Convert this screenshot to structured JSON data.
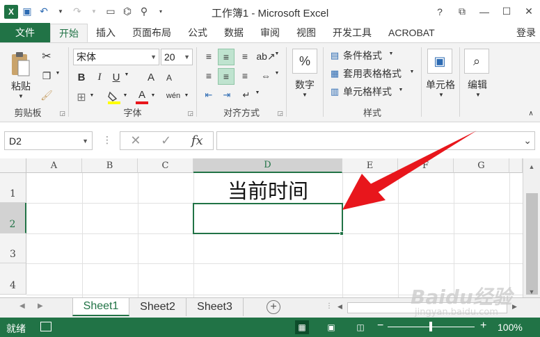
{
  "title_bar": {
    "title": "工作簿1 - Microsoft Excel",
    "logo": "X",
    "qat_icons": [
      "save-icon",
      "undo-icon",
      "redo-icon",
      "form-icon",
      "tree-icon",
      "pin-icon",
      "customize-icon"
    ],
    "window_buttons": [
      "?",
      "⧉",
      "—",
      "☐",
      "✕"
    ]
  },
  "tabs": {
    "file": "文件",
    "items": [
      "开始",
      "插入",
      "页面布局",
      "公式",
      "数据",
      "审阅",
      "视图",
      "开发工具",
      "ACROBAT"
    ],
    "active": "开始",
    "login": "登录"
  },
  "ribbon": {
    "clipboard": {
      "paste": "粘贴",
      "label": "剪贴板"
    },
    "font": {
      "name": "宋体",
      "size": "20",
      "bold": "B",
      "italic": "I",
      "underline": "U",
      "grow": "A",
      "shrink": "A",
      "font_color_glyph": "A",
      "wen": "wén",
      "label": "字体"
    },
    "alignment": {
      "label": "对齐方式"
    },
    "number": {
      "glyph": "%",
      "label_btn": "数字"
    },
    "styles": {
      "conditional": "条件格式",
      "table": "套用表格格式",
      "cell": "单元格样式",
      "label": "样式"
    },
    "cells": {
      "label_btn": "单元格"
    },
    "editing": {
      "label_btn": "编辑"
    }
  },
  "formula_bar": {
    "name_box": "D2",
    "cancel": "✕",
    "enter": "✓",
    "fx": "fx",
    "value": ""
  },
  "grid": {
    "columns": [
      "A",
      "B",
      "C",
      "D",
      "E",
      "F",
      "G"
    ],
    "selected_column": "D",
    "rows": [
      "1",
      "2",
      "3",
      "4"
    ],
    "selected_row": "2",
    "cells": {
      "D1": "当前时间"
    }
  },
  "sheets": {
    "tabs": [
      "Sheet1",
      "Sheet2",
      "Sheet3"
    ],
    "active": "Sheet1",
    "add": "+"
  },
  "status_bar": {
    "status": "就绪",
    "zoom": "100%",
    "zoom_minus": "−",
    "zoom_plus": "+"
  },
  "watermark": {
    "line1": "Baidu经验",
    "line2": "jingyan.baidu.com"
  },
  "colors": {
    "excel_green": "#217346",
    "arrow_red": "#e8161c"
  }
}
